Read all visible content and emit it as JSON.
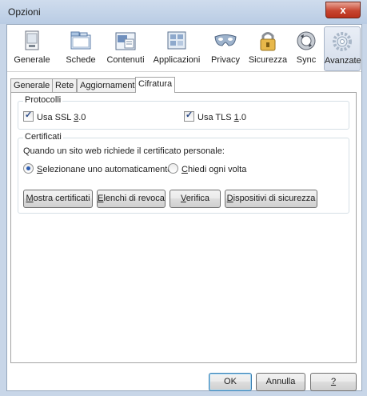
{
  "window": {
    "title": "Opzioni",
    "close_glyph": "x"
  },
  "toolbar": {
    "items": [
      {
        "label": "Generale",
        "icon": "window-icon"
      },
      {
        "label": "Schede",
        "icon": "tabs-icon"
      },
      {
        "label": "Contenuti",
        "icon": "content-icon"
      },
      {
        "label": "Applicazioni",
        "icon": "applications-icon"
      },
      {
        "label": "Privacy",
        "icon": "mask-icon"
      },
      {
        "label": "Sicurezza",
        "icon": "padlock-icon"
      },
      {
        "label": "Sync",
        "icon": "sync-icon"
      },
      {
        "label": "Avanzate",
        "icon": "gear-icon"
      }
    ],
    "active": "Avanzate"
  },
  "tabs": [
    "Generale",
    "Rete",
    "Aggiornamenti",
    "Cifratura"
  ],
  "active_tab": "Cifratura",
  "protocolli": {
    "title": "Protocolli",
    "ssl": {
      "pre": "Usa SSL ",
      "key": "3",
      "post": ".0",
      "checked": true
    },
    "tls": {
      "pre": "Usa TLS ",
      "key": "1",
      "post": ".0",
      "checked": true
    }
  },
  "certificati": {
    "title": "Certificati",
    "question": "Quando un sito web richiede il certificato personale:",
    "radio_auto": {
      "key": "S",
      "rest": "elezionane uno automaticamente",
      "selected": true
    },
    "radio_ask": {
      "key": "C",
      "rest": "hiedi ogni volta",
      "selected": false
    },
    "buttons": {
      "mostra": {
        "key": "M",
        "rest": "ostra certificati"
      },
      "elenchi": {
        "key": "E",
        "rest": "lenchi di revoca"
      },
      "verifica": {
        "key": "V",
        "rest": "erifica"
      },
      "dispositivi": {
        "key": "D",
        "rest": "ispositivi di sicurezza"
      }
    }
  },
  "footer": {
    "ok": "OK",
    "annulla": "Annulla",
    "help": "?"
  },
  "colors": {
    "accent": "#2e5db0",
    "active_toolbar": "#d4dcea",
    "close": "#c74530"
  }
}
